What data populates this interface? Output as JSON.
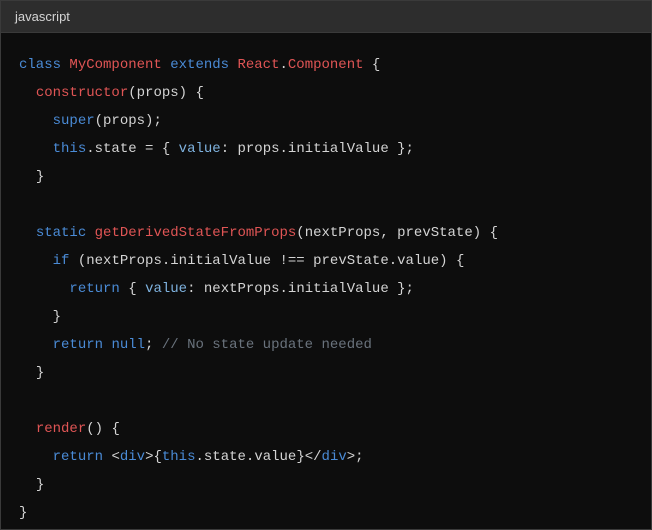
{
  "header": {
    "language_label": "javascript"
  },
  "code": {
    "tokens": [
      [
        [
          "kw",
          "class"
        ],
        [
          "",
          ""
        ],
        [
          "class",
          "MyComponent"
        ],
        [
          "",
          ""
        ],
        [
          "kw",
          "extends"
        ],
        [
          "",
          ""
        ],
        [
          "type",
          "React"
        ],
        [
          "punc",
          "."
        ],
        [
          "type",
          "Component"
        ],
        [
          "",
          ""
        ],
        [
          "punc",
          "{"
        ]
      ],
      [
        [
          "",
          "  "
        ],
        [
          "fn",
          "constructor"
        ],
        [
          "punc",
          "("
        ],
        [
          "ident",
          "props"
        ],
        [
          "punc",
          ")"
        ],
        [
          "",
          ""
        ],
        [
          "punc",
          "{"
        ]
      ],
      [
        [
          "",
          "    "
        ],
        [
          "kw",
          "super"
        ],
        [
          "punc",
          "("
        ],
        [
          "ident",
          "props"
        ],
        [
          "punc",
          ");"
        ]
      ],
      [
        [
          "",
          "    "
        ],
        [
          "this",
          "this"
        ],
        [
          "punc",
          "."
        ],
        [
          "ident",
          "state"
        ],
        [
          "",
          ""
        ],
        [
          "punc",
          "="
        ],
        [
          "",
          ""
        ],
        [
          "punc",
          "{"
        ],
        [
          "",
          ""
        ],
        [
          "prop",
          "value"
        ],
        [
          "punc",
          ":"
        ],
        [
          "",
          ""
        ],
        [
          "ident",
          "props"
        ],
        [
          "punc",
          "."
        ],
        [
          "ident",
          "initialValue"
        ],
        [
          "",
          ""
        ],
        [
          "punc",
          "};"
        ]
      ],
      [
        [
          "",
          "  "
        ],
        [
          "punc",
          "}"
        ]
      ],
      [],
      [
        [
          "",
          "  "
        ],
        [
          "kw",
          "static"
        ],
        [
          "",
          ""
        ],
        [
          "fn",
          "getDerivedStateFromProps"
        ],
        [
          "punc",
          "("
        ],
        [
          "ident",
          "nextProps"
        ],
        [
          "punc",
          ","
        ],
        [
          "",
          ""
        ],
        [
          "ident",
          "prevState"
        ],
        [
          "punc",
          ")"
        ],
        [
          "",
          ""
        ],
        [
          "punc",
          "{"
        ]
      ],
      [
        [
          "",
          "    "
        ],
        [
          "kw",
          "if"
        ],
        [
          "",
          ""
        ],
        [
          "punc",
          "("
        ],
        [
          "ident",
          "nextProps"
        ],
        [
          "punc",
          "."
        ],
        [
          "ident",
          "initialValue"
        ],
        [
          "",
          ""
        ],
        [
          "punc",
          "!=="
        ],
        [
          "",
          ""
        ],
        [
          "ident",
          "prevState"
        ],
        [
          "punc",
          "."
        ],
        [
          "ident",
          "value"
        ],
        [
          "punc",
          ")"
        ],
        [
          "",
          ""
        ],
        [
          "punc",
          "{"
        ]
      ],
      [
        [
          "",
          "      "
        ],
        [
          "kw",
          "return"
        ],
        [
          "",
          ""
        ],
        [
          "punc",
          "{"
        ],
        [
          "",
          ""
        ],
        [
          "prop",
          "value"
        ],
        [
          "punc",
          ":"
        ],
        [
          "",
          ""
        ],
        [
          "ident",
          "nextProps"
        ],
        [
          "punc",
          "."
        ],
        [
          "ident",
          "initialValue"
        ],
        [
          "",
          ""
        ],
        [
          "punc",
          "};"
        ]
      ],
      [
        [
          "",
          "    "
        ],
        [
          "punc",
          "}"
        ]
      ],
      [
        [
          "",
          "    "
        ],
        [
          "kw",
          "return"
        ],
        [
          "",
          ""
        ],
        [
          "null",
          "null"
        ],
        [
          "punc",
          ";"
        ],
        [
          "",
          ""
        ],
        [
          "comment",
          "// No state update needed"
        ]
      ],
      [
        [
          "",
          "  "
        ],
        [
          "punc",
          "}"
        ]
      ],
      [],
      [
        [
          "",
          "  "
        ],
        [
          "fn",
          "render"
        ],
        [
          "punc",
          "()"
        ],
        [
          "",
          ""
        ],
        [
          "punc",
          "{"
        ]
      ],
      [
        [
          "",
          "    "
        ],
        [
          "kw",
          "return"
        ],
        [
          "",
          ""
        ],
        [
          "punc",
          "<"
        ],
        [
          "tag",
          "div"
        ],
        [
          "punc",
          ">{"
        ],
        [
          "this",
          "this"
        ],
        [
          "punc",
          "."
        ],
        [
          "ident",
          "state"
        ],
        [
          "punc",
          "."
        ],
        [
          "ident",
          "value"
        ],
        [
          "punc",
          "}</"
        ],
        [
          "tag",
          "div"
        ],
        [
          "punc",
          ">;"
        ]
      ],
      [
        [
          "",
          "  "
        ],
        [
          "punc",
          "}"
        ]
      ],
      [
        [
          "punc",
          "}"
        ]
      ]
    ]
  }
}
